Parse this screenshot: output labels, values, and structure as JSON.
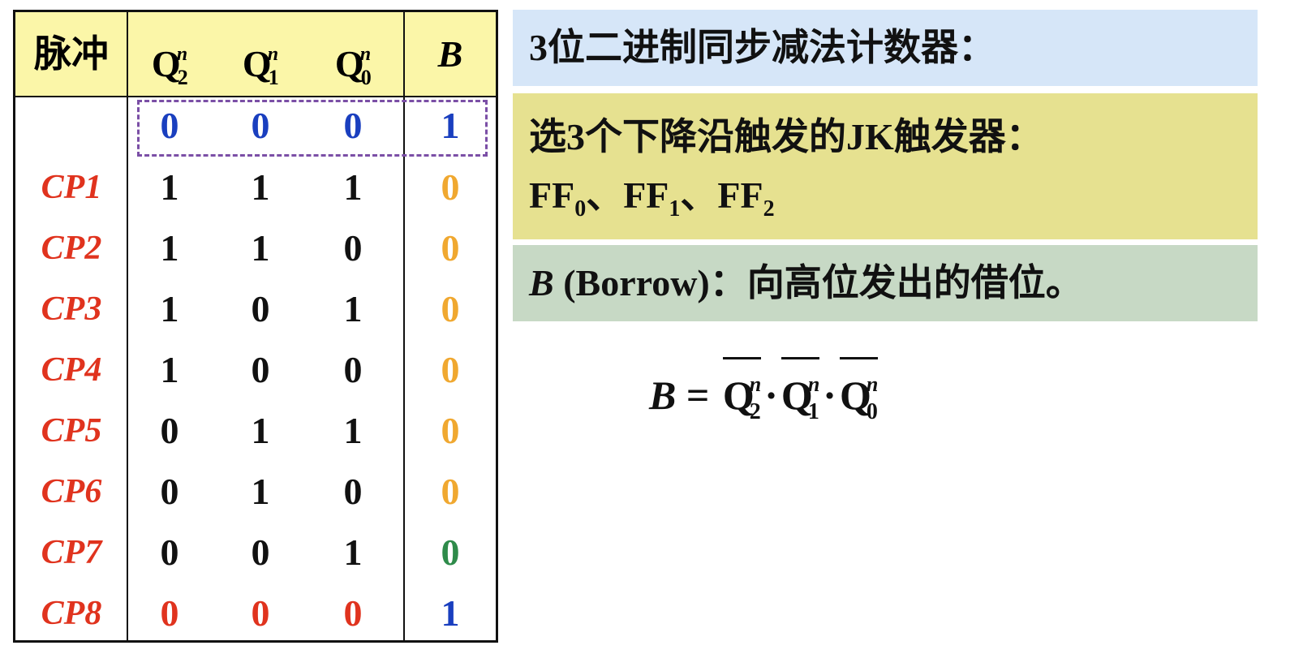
{
  "table": {
    "headers": {
      "pulse": "脉冲",
      "q2": "Q",
      "q2_sub": "2",
      "q1": "Q",
      "q1_sub": "1",
      "q0": "Q",
      "q0_sub": "0",
      "sup": "n",
      "b": "B"
    },
    "initial": {
      "q2": "0",
      "q1": "0",
      "q0": "0",
      "b": "1"
    },
    "rows": [
      {
        "pulse": "CP1",
        "q2": "1",
        "q1": "1",
        "q0": "1",
        "b": "0"
      },
      {
        "pulse": "CP2",
        "q2": "1",
        "q1": "1",
        "q0": "0",
        "b": "0"
      },
      {
        "pulse": "CP3",
        "q2": "1",
        "q1": "0",
        "q0": "1",
        "b": "0"
      },
      {
        "pulse": "CP4",
        "q2": "1",
        "q1": "0",
        "q0": "0",
        "b": "0"
      },
      {
        "pulse": "CP5",
        "q2": "0",
        "q1": "1",
        "q0": "1",
        "b": "0"
      },
      {
        "pulse": "CP6",
        "q2": "0",
        "q1": "1",
        "q0": "0",
        "b": "0"
      },
      {
        "pulse": "CP7",
        "q2": "0",
        "q1": "0",
        "q0": "1",
        "b": "0"
      },
      {
        "pulse": "CP8",
        "q2": "0",
        "q1": "0",
        "q0": "0",
        "b": "1"
      }
    ]
  },
  "boxes": {
    "title": "3位二进制同步减法计数器：",
    "ff_line1": "选3个下降沿触发的JK触发器：",
    "ff_line2": {
      "a": "FF",
      "a_sub": "0",
      "sep1": "、",
      "b": "FF",
      "b_sub": "1",
      "sep2": "、",
      "c": "FF",
      "c_sub": "2"
    },
    "borrow_b": "B",
    "borrow_text": " (Borrow)：向高位发出的借位。"
  },
  "formula": {
    "lhs": "B",
    "eq": " = ",
    "q": "Q",
    "sup": "n",
    "s2": "2",
    "s1": "1",
    "s0": "0",
    "dot": "·"
  },
  "colors": {
    "blue": "#1a3fbf",
    "orange": "#f0a830",
    "green": "#2e8b4a",
    "red": "#e0331e",
    "title_bg": "#d6e6f8",
    "ff_bg": "#e6e190",
    "borrow_bg": "#c7d9c5"
  }
}
